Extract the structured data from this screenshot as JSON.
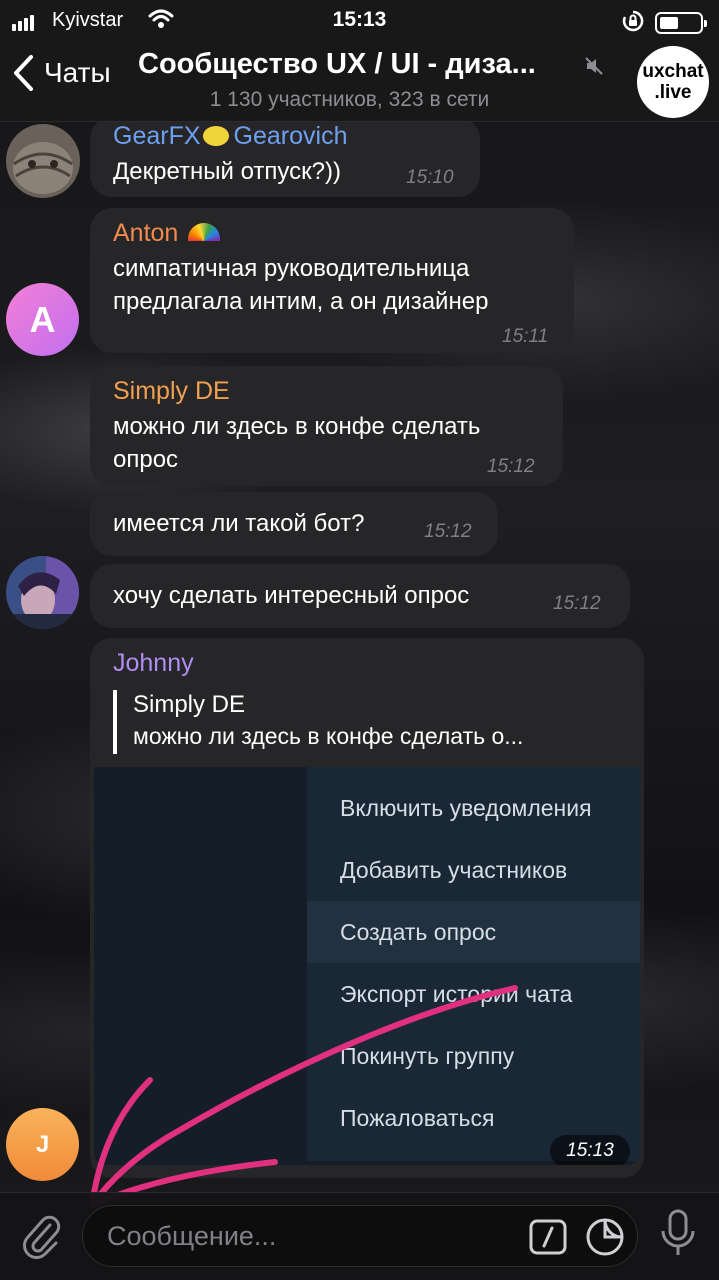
{
  "status_bar": {
    "carrier": "Kyivstar",
    "time": "15:13"
  },
  "header": {
    "back_label": "Чаты",
    "title": "Сообщество UX / UI - диза...",
    "subtitle": "1 130 участников, 323 в сети",
    "avatar_line1": "uxchat",
    "avatar_line2": ".live"
  },
  "messages": [
    {
      "sender": "GearFX",
      "sender2": "Gearovich",
      "text": "Декретный отпуск?))",
      "time": "15:10",
      "name_color": "#6ea0f0"
    },
    {
      "sender": "Anton",
      "text_line1": "симпатичная руководительница",
      "text_line2": "предлагала интим, а он дизайнер",
      "time": "15:11",
      "name_color": "#f08a4e",
      "avatar_letter": "A"
    },
    {
      "sender": "Simply DE",
      "text_line1": "можно ли здесь в конфе сделать",
      "text_line2": "опрос",
      "time": "15:12",
      "name_color": "#f0a050"
    },
    {
      "text": "имеется ли такой бот?",
      "time": "15:12"
    },
    {
      "text": "хочу сделать интересный опрос",
      "time": "15:12"
    },
    {
      "sender": "Johnny",
      "name_color": "#b08df0",
      "time": "15:13",
      "avatar_letter": "J",
      "reply": {
        "sender": "Simply DE",
        "text": "можно ли здесь в конфе сделать о..."
      },
      "menu_items": [
        "Включить уведомления",
        "Добавить участников",
        "Создать опрос",
        "Экспорт истории чата",
        "Покинуть группу",
        "Пожаловаться"
      ],
      "highlighted_item": 2
    }
  ],
  "input": {
    "placeholder": "Сообщение..."
  },
  "colors": {
    "annotation_arrow": "#e0307f",
    "bubble": "#262628"
  },
  "icons": [
    "signal-icon",
    "wifi-icon",
    "rotation-lock-icon",
    "battery-icon",
    "back-chevron-icon",
    "mute-icon",
    "paperclip-icon",
    "command-icon",
    "sticker-icon",
    "microphone-icon",
    "rainbow-emoji",
    "lemon-emoji"
  ]
}
